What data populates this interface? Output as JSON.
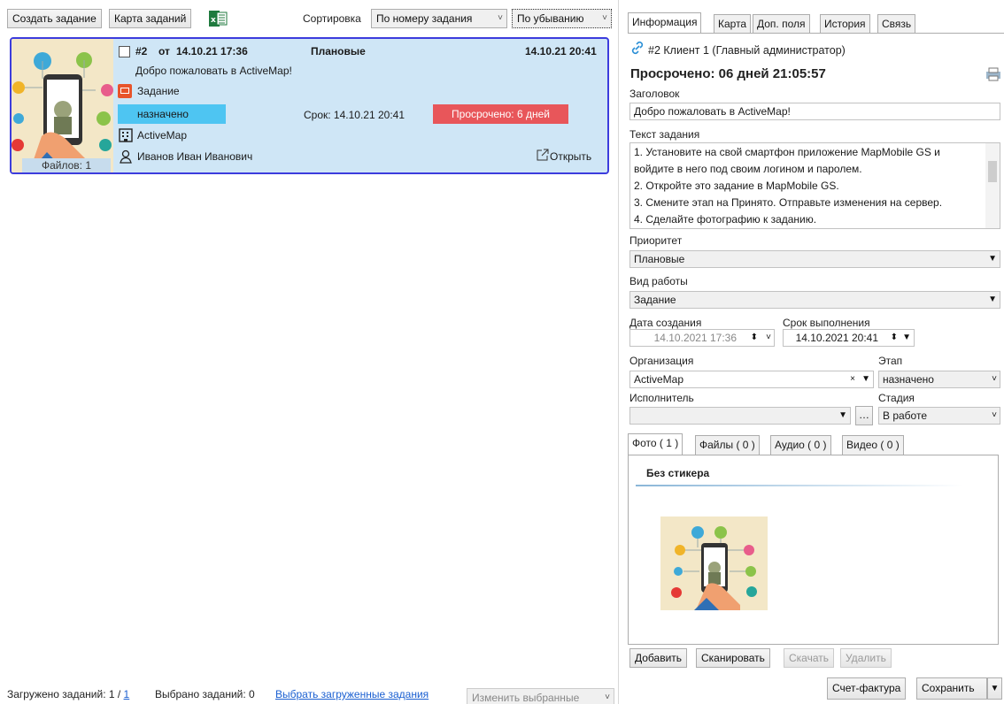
{
  "toolbar": {
    "create_task": "Создать задание",
    "task_map": "Карта заданий",
    "sort_label": "Сортировка",
    "sort_by": "По номеру задания",
    "sort_order": "По убыванию"
  },
  "card": {
    "number": "#2",
    "from": "от",
    "created": "14.10.21 17:36",
    "priority": "Плановые",
    "deadline_date": "14.10.21 20:41",
    "title": "Добро пожаловать в ActiveMap!",
    "work_type": "Задание",
    "stage": "назначено",
    "due": "Срок: 14.10.21 20:41",
    "overdue": "Просрочено: 6 дней",
    "organization": "ActiveMap",
    "assignee": "Иванов Иван Иванович",
    "open": "Открыть",
    "files": "Файлов: 1",
    "stage_color": "#4ec5f2",
    "overdue_color": "#e8565a"
  },
  "footer": {
    "loaded": "Загружено заданий: 1 /",
    "loaded_link": "1",
    "selected": "Выбрано заданий: 0",
    "select_loaded": "Выбрать загруженные задания",
    "change_selected": "Изменить выбранные"
  },
  "tabs": [
    "Информация",
    "Карта",
    "Доп. поля",
    "История",
    "Связь"
  ],
  "info": {
    "header": "#2  Клиент 1 (Главный администратор)",
    "overdue": "Просрочено: 06 дней 21:05:57",
    "title_label": "Заголовок",
    "title_value": "Добро пожаловать в ActiveMap!",
    "text_label": "Текст задания",
    "text_lines": [
      "1. Установите на свой смартфон приложение MapMobile GS и",
      "войдите в него под своим логином и паролем.",
      "2. Откройте это задание в MapMobile GS.",
      "3. Смените этап на Принято. Отправьте изменения на сервер.",
      "4. Сделайте фотографию к заданию."
    ],
    "priority_label": "Приоритет",
    "priority_value": "Плановые",
    "worktype_label": "Вид работы",
    "worktype_value": "Задание",
    "created_label": "Дата создания",
    "created_value": "14.10.2021 17:36",
    "deadline_label": "Срок выполнения",
    "deadline_value": "14.10.2021 20:41",
    "org_label": "Организация",
    "org_value": "ActiveMap",
    "stage_label": "Этап",
    "stage_value": "назначено",
    "assignee_label": "Исполнитель",
    "assignee_value": "",
    "phase_label": "Стадия",
    "phase_value": "В работе"
  },
  "media_tabs": [
    "Фото ( 1 )",
    "Файлы ( 0 )",
    "Аудио ( 0 )",
    "Видео ( 0 )"
  ],
  "photo": {
    "sticker": "Без стикера"
  },
  "media_buttons": {
    "add": "Добавить",
    "scan": "Сканировать",
    "download": "Скачать",
    "delete": "Удалить"
  },
  "bottom_buttons": {
    "invoice": "Счет-фактура",
    "save": "Сохранить"
  }
}
